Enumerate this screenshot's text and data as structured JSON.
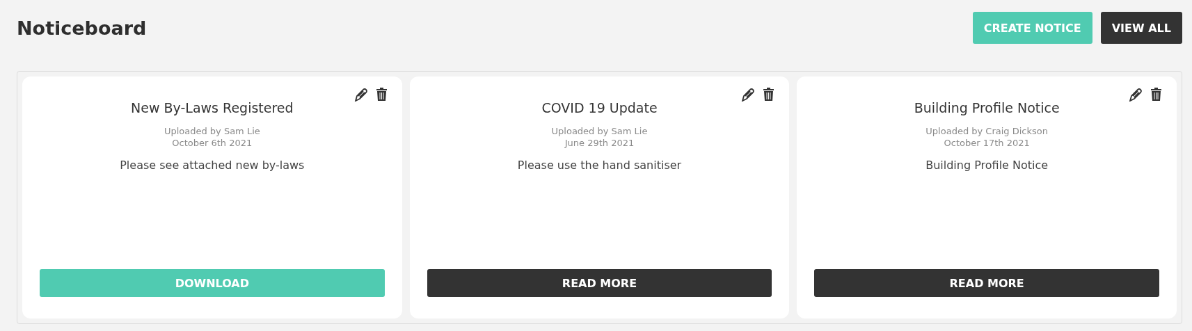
{
  "header": {
    "title": "Noticeboard",
    "buttons": [
      {
        "label": "CREATE NOTICE",
        "kind": "primary"
      },
      {
        "label": "VIEW ALL",
        "kind": "dark"
      }
    ]
  },
  "notices": [
    {
      "title": "New By-Laws Registered",
      "uploaded_by": "Uploaded by Sam Lie",
      "date": "October 6th 2021",
      "body": "Please see attached new by-laws",
      "action": {
        "label": "DOWNLOAD",
        "kind": "primary"
      }
    },
    {
      "title": "COVID 19 Update",
      "uploaded_by": "Uploaded by Sam Lie",
      "date": "June 29th 2021",
      "body": "Please use the hand sanitiser",
      "action": {
        "label": "READ MORE",
        "kind": "dark"
      }
    },
    {
      "title": "Building Profile Notice",
      "uploaded_by": "Uploaded by Craig Dickson",
      "date": "October 17th 2021",
      "body": "Building Profile Notice",
      "action": {
        "label": "READ MORE",
        "kind": "dark"
      }
    }
  ]
}
